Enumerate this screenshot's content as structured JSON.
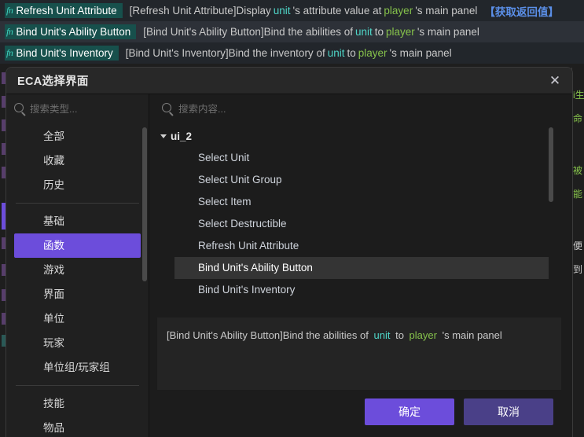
{
  "background": {
    "rows": [
      {
        "icon": "function-icon",
        "icon_glyph": "fn",
        "chip_label": "Refresh Unit Attribute",
        "prefix": "[Refresh Unit Attribute]Display",
        "token_unit": "unit",
        "mid": "'s attribute value at",
        "token_player": "player",
        "suffix": "'s main panel",
        "return_label": "【获取返回值】"
      },
      {
        "icon": "function-icon",
        "icon_glyph": "fn",
        "chip_label": "Bind Unit's Ability Button",
        "prefix": "[Bind Unit's Ability Button]Bind the abilities of",
        "token_unit": "unit",
        "mid": "to",
        "token_player": "player",
        "suffix": "'s main panel",
        "return_label": ""
      },
      {
        "icon": "function-icon",
        "icon_glyph": "fn",
        "chip_label": "Bind Unit's Inventory",
        "prefix": "[Bind Unit's Inventory]Bind the inventory of",
        "token_unit": "unit",
        "mid": "to",
        "token_player": "player",
        "suffix": "'s main panel",
        "return_label": ""
      }
    ],
    "right_edge_fragments": [
      "i生",
      "命",
      "被",
      "能",
      "便",
      "到"
    ]
  },
  "dialog": {
    "title": "ECA选择界面",
    "close_icon": "close-icon",
    "left": {
      "search": {
        "icon": "search-icon",
        "placeholder": "搜索类型...",
        "value": ""
      },
      "categories": [
        {
          "label": "全部",
          "active": false
        },
        {
          "label": "收藏",
          "active": false
        },
        {
          "label": "历史",
          "active": false
        },
        {
          "separator": true
        },
        {
          "label": "基础",
          "active": false
        },
        {
          "label": "函数",
          "active": true
        },
        {
          "label": "游戏",
          "active": false
        },
        {
          "label": "界面",
          "active": false
        },
        {
          "label": "单位",
          "active": false
        },
        {
          "label": "玩家",
          "active": false
        },
        {
          "label": "单位组/玩家组",
          "active": false
        },
        {
          "separator": true
        },
        {
          "label": "技能",
          "active": false
        },
        {
          "label": "物品",
          "active": false
        }
      ]
    },
    "right": {
      "search": {
        "icon": "search-icon",
        "placeholder": "搜索内容...",
        "value": ""
      },
      "tree": {
        "group_label": "ui_2",
        "expanded": true,
        "items": [
          {
            "label": "Select Unit",
            "selected": false
          },
          {
            "label": "Select Unit Group",
            "selected": false
          },
          {
            "label": "Select Item",
            "selected": false
          },
          {
            "label": "Select Destructible",
            "selected": false
          },
          {
            "label": "Refresh Unit Attribute",
            "selected": false
          },
          {
            "label": "Bind Unit's Ability Button",
            "selected": true
          },
          {
            "label": "Bind Unit's Inventory",
            "selected": false
          }
        ]
      },
      "detail": {
        "prefix": "[Bind Unit's Ability Button]Bind the abilities of",
        "token_unit": "unit",
        "mid": "to",
        "token_player": "player",
        "suffix": "'s main panel"
      }
    },
    "footer": {
      "confirm_label": "确定",
      "cancel_label": "取消"
    }
  },
  "colors": {
    "accent": "#6c4ddb",
    "accent_dim": "#4a4088",
    "token_unit": "#4fd6c8",
    "token_player": "#86c24b",
    "return_blue": "#5b8fe8",
    "chip_bg": "#17504c"
  }
}
